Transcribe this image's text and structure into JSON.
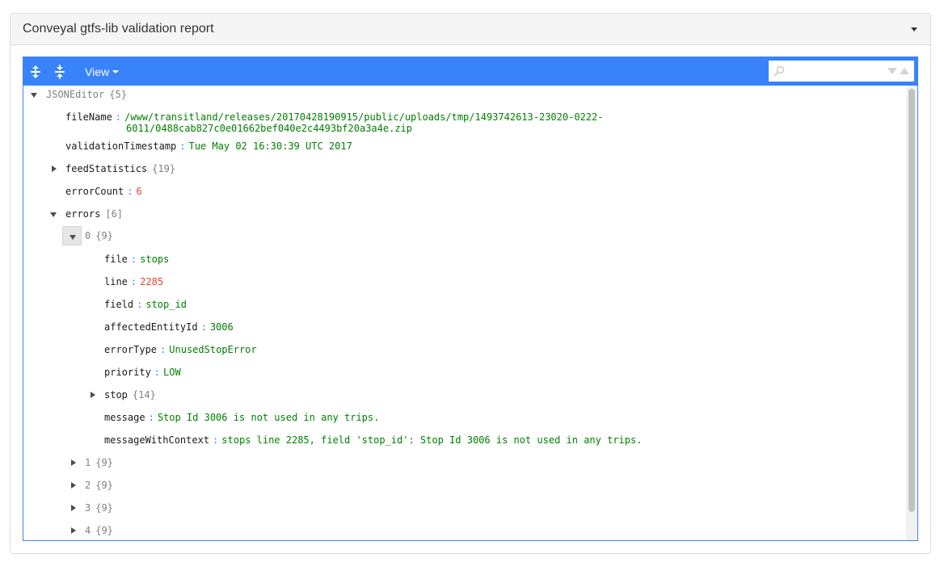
{
  "panel": {
    "title": "Conveyal gtfs-lib validation report"
  },
  "editor": {
    "menu": {
      "expand_all_icon": "expand-all-icon",
      "collapse_all_icon": "collapse-all-icon",
      "view_label": "View",
      "accent_color": "#3883fa"
    },
    "search": {
      "value": "",
      "icon": "search-icon"
    },
    "tree": {
      "root": {
        "key": "JSONEditor",
        "meta": "{5}"
      },
      "fileName": {
        "key": "fileName",
        "value_line1": "/www/transitland/releases/20170428190915/public/uploads/tmp/1493742613-23020-0222-",
        "value_line2": "6011/0488cab827c0e01662bef040e2c4493bf20a3a4e.zip"
      },
      "validationTimestamp": {
        "key": "validationTimestamp",
        "value": "Tue May 02 16:30:39 UTC 2017"
      },
      "feedStatistics": {
        "key": "feedStatistics",
        "meta": "{19}"
      },
      "errorCount": {
        "key": "errorCount",
        "value": "6"
      },
      "errors": {
        "key": "errors",
        "meta": "[6]"
      },
      "error0": {
        "key": "0",
        "meta": "{9}",
        "fields": [
          {
            "key": "file",
            "value": "stops",
            "kind": "str"
          },
          {
            "key": "line",
            "value": "2285",
            "kind": "num"
          },
          {
            "key": "field",
            "value": "stop_id",
            "kind": "str"
          },
          {
            "key": "affectedEntityId",
            "value": "3006",
            "kind": "str"
          },
          {
            "key": "errorType",
            "value": "UnusedStopError",
            "kind": "str"
          },
          {
            "key": "priority",
            "value": "LOW",
            "kind": "str"
          }
        ],
        "stop": {
          "key": "stop",
          "meta": "{14}"
        },
        "message": {
          "key": "message",
          "value": "Stop Id 3006 is not used in any trips."
        },
        "messageWithContext": {
          "key": "messageWithContext",
          "value": "stops line 2285, field 'stop_id': Stop Id 3006 is not used in any trips."
        }
      },
      "collapsed_errors": [
        {
          "key": "1",
          "meta": "{9}"
        },
        {
          "key": "2",
          "meta": "{9}"
        },
        {
          "key": "3",
          "meta": "{9}"
        },
        {
          "key": "4",
          "meta": "{9}"
        }
      ]
    },
    "colors": {
      "string": "#008000",
      "number": "#ee422e",
      "separator": "#3883fa",
      "meta": "#808080"
    }
  }
}
